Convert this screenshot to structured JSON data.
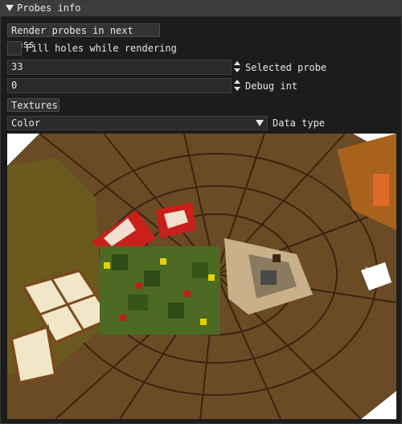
{
  "window": {
    "title": "Probes info"
  },
  "controls": {
    "render_button": "Render probes in next pass",
    "fill_holes_label": "Fill holes while rendering",
    "selected_probe": {
      "value": "33",
      "label": "Selected probe"
    },
    "debug_int": {
      "value": "0",
      "label": "Debug int"
    },
    "textures_button": "Textures",
    "data_type": {
      "value": "Color",
      "label": "Data type"
    }
  },
  "icons": [
    "chevron-down-icon",
    "stepper-icon",
    "checkbox-empty-icon"
  ],
  "colors": {
    "wood": "#8a5a2b",
    "dark_wood": "#5a3a1a",
    "grass": "#5b7a2a",
    "sky": "#ffffff"
  }
}
